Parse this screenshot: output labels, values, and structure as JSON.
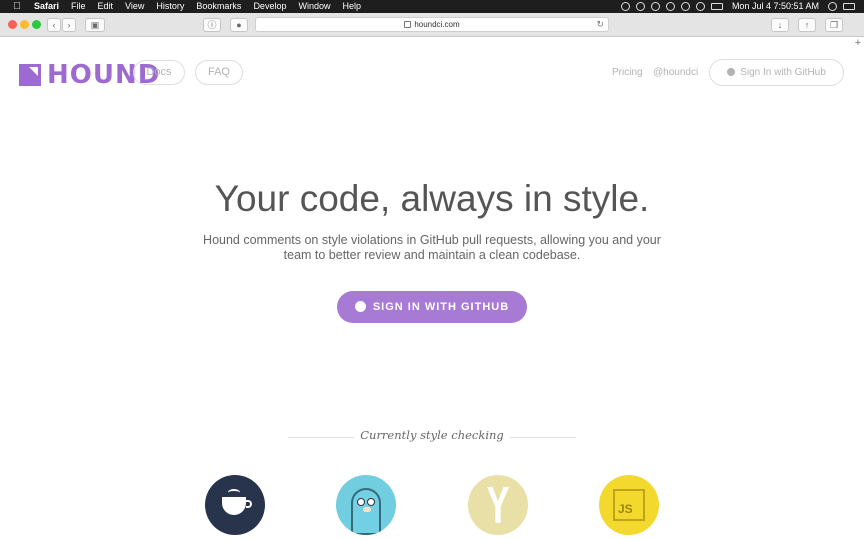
{
  "menubar": {
    "app": "Safari",
    "items": [
      "File",
      "Edit",
      "View",
      "History",
      "Bookmarks",
      "Develop",
      "Window",
      "Help"
    ],
    "clock": "Mon Jul 4  7:50:51 AM"
  },
  "browser": {
    "url": "houndci.com"
  },
  "header": {
    "logo_text": "HOUND",
    "docs_label": "Docs",
    "faq_label": "FAQ",
    "pricing_label": "Pricing",
    "twitter_label": "@houndci",
    "signin_label": "Sign In with GitHub"
  },
  "hero": {
    "title": "Your code, always in style.",
    "subtitle": "Hound comments on style violations in GitHub pull requests, allowing you and your team to better review and maintain a clean codebase.",
    "cta_label": "SIGN IN WITH GITHUB"
  },
  "languages": {
    "title": "Currently style checking",
    "js_text": "JS"
  },
  "colors": {
    "brand": "#9c6ad1",
    "cta": "#a77ad6"
  }
}
